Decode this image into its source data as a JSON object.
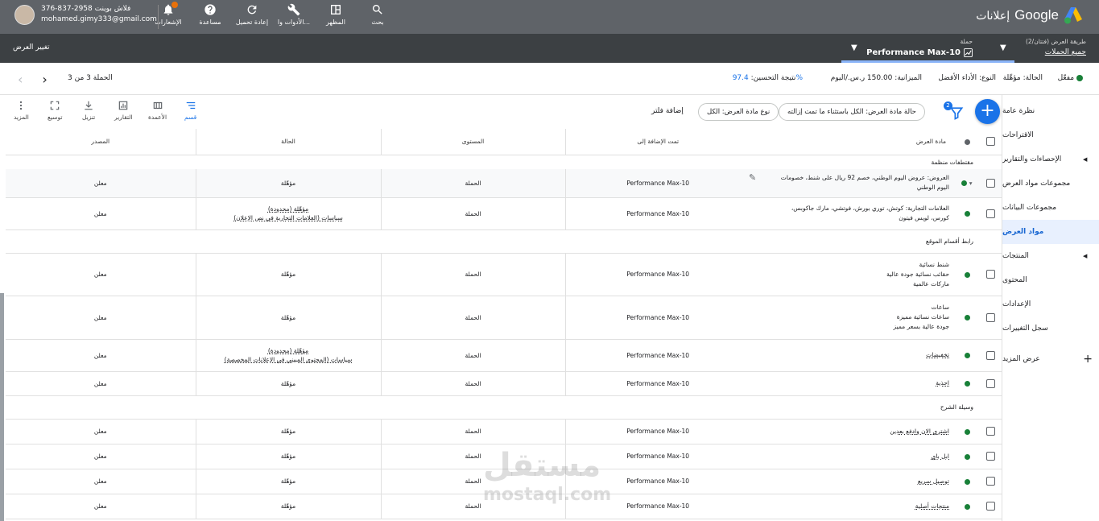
{
  "header": {
    "product_name": "إعلانات",
    "brand": "Google",
    "account_phone": "376-837-2958 فلاش بوينت",
    "account_email": "mohamed.gimy333@gmail.com",
    "icons": [
      {
        "name": "search-icon",
        "label": "بحث"
      },
      {
        "name": "appearance-icon",
        "label": "المظهر"
      },
      {
        "name": "tools-icon",
        "label": "الأدوات وا..."
      },
      {
        "name": "refresh-icon",
        "label": "إعادة تحميل"
      },
      {
        "name": "help-icon",
        "label": "مساعدة"
      },
      {
        "name": "notifications-icon",
        "label": "الإشعارات"
      }
    ]
  },
  "subbar": {
    "change_view": "تغيير العرض",
    "view_label": "طريقة العرض (فتتان/2)",
    "view_value": "جميع الحملات",
    "campaign_label": "حملة",
    "campaign_value": "Performance Max-10"
  },
  "status": {
    "enabled": "مفعّل",
    "status_label": "الحالة: مؤهّلة",
    "type_label": "النوع: الأداء الأفضل",
    "budget_label": "الميزانية: 150.00 ر.س./اليوم",
    "optimization_label": "نتيجة التحسين:",
    "optimization_value": "97.4%",
    "pager": "الحملة 3 من 3"
  },
  "toolbar": {
    "segment": "قسم",
    "columns": "الأعمدة",
    "reports": "التقارير",
    "download": "تنزيل",
    "expand": "توسيع",
    "more": "المزيد",
    "chip_status": "حالة مادة العرض: الكل باستثناء ما تمت إزالته",
    "chip_type": "نوع مادة العرض: الكل",
    "add_filter": "إضافة فلتر",
    "filter_count": "2"
  },
  "sidenav": {
    "items": [
      {
        "label": "نظرة عامة"
      },
      {
        "label": "الاقتراحات"
      },
      {
        "label": "الإحصاءات والتقارير"
      },
      {
        "label": "مجموعات مواد العرض"
      },
      {
        "label": "مجموعات البيانات"
      },
      {
        "label": "مواد العرض"
      },
      {
        "label": "المنتجات"
      },
      {
        "label": "المحتوى"
      },
      {
        "label": "الإعدادات"
      },
      {
        "label": "سجل التغييرات"
      }
    ],
    "show_more": "عرض المزيد"
  },
  "table": {
    "columns": {
      "asset": "مادة العرض",
      "added_to": "تمت الإضافة إلى",
      "level": "المستوى",
      "status": "الحالة",
      "source": "المصدر"
    },
    "sections": [
      {
        "title": "مقتطفات منظمة",
        "rows": [
          {
            "asset": [
              "العروض: عروض اليوم الوطني، خصم 92 ريال على شنط، خصومات",
              "اليوم الوطني"
            ],
            "added_to": "Performance Max-10",
            "level": "الحملة",
            "status": [
              "مؤهّلة"
            ],
            "source": "معلن"
          },
          {
            "asset": [
              "العلامات التجارية: كوتش، توري بورش، فوتشي، مارك جاكوبس،",
              "كورس، لويس فيتون"
            ],
            "added_to": "Performance Max-10",
            "level": "الحملة",
            "status": [
              "مؤهّلة (محدودة)",
              "سياسات (العلامات التجارية في نص الإعلان)"
            ],
            "source": "معلن"
          }
        ]
      },
      {
        "title": "رابط أقسام الموقع",
        "rows": [
          {
            "asset": [
              "شنط نسائية",
              "حقائب نسائية جودة عالية",
              "ماركات عالمية"
            ],
            "added_to": "Performance Max-10",
            "level": "الحملة",
            "status": [
              "مؤهّلة"
            ],
            "source": "معلن"
          },
          {
            "asset": [
              "ساعات",
              "ساعات نسائية مميزة",
              "جودة عالية بسعر مميز"
            ],
            "added_to": "Performance Max-10",
            "level": "الحملة",
            "status": [
              "مؤهّلة"
            ],
            "source": "معلن"
          },
          {
            "asset": [
              "تخفيضات"
            ],
            "added_to": "Performance Max-10",
            "level": "الحملة",
            "status": [
              "مؤهّلة (محدودة)",
              "سياسات (المحتوى المبيني في الإعلانات المخصصة)"
            ],
            "source": "معلن"
          },
          {
            "asset": [
              "احذية"
            ],
            "added_to": "Performance Max-10",
            "level": "الحملة",
            "status": [
              "مؤهّلة"
            ],
            "source": "معلن"
          }
        ]
      },
      {
        "title": "وسيلة الشرح",
        "rows": [
          {
            "asset": [
              "اشتري الان وادفع بعدين"
            ],
            "added_to": "Performance Max-10",
            "level": "الحملة",
            "status": [
              "مؤهّلة"
            ],
            "source": "معلن"
          },
          {
            "asset": [
              "ابل باي"
            ],
            "added_to": "Performance Max-10",
            "level": "الحملة",
            "status": [
              "مؤهّلة"
            ],
            "source": "معلن"
          },
          {
            "asset": [
              "توصيل سريع"
            ],
            "added_to": "Performance Max-10",
            "level": "الحملة",
            "status": [
              "مؤهّلة"
            ],
            "source": "معلن"
          },
          {
            "asset": [
              "منتجات أصلية"
            ],
            "added_to": "Performance Max-10",
            "level": "الحملة",
            "status": [
              "مؤهّلة"
            ],
            "source": "معلن"
          }
        ]
      }
    ]
  },
  "watermark": {
    "ar": "مستقل",
    "en": "mostaql.com"
  },
  "colors": {
    "accent": "#1a73e8",
    "topbar": "#5f6368",
    "subbar": "#3c4043",
    "eligible": "#188038"
  }
}
